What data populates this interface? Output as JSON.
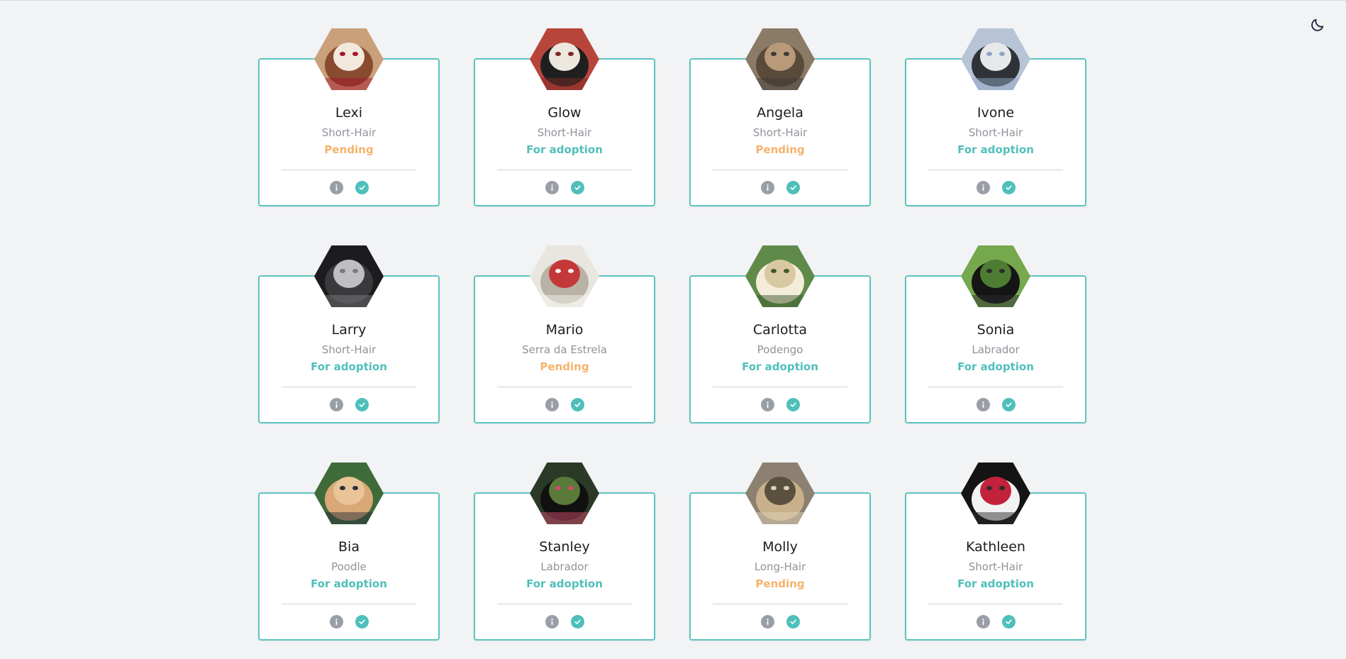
{
  "header": {
    "theme_toggle_icon": "moon-icon"
  },
  "colors": {
    "accent": "#5ec4c0",
    "pending": "#f6b26b",
    "for_adoption": "#4fbfbb",
    "background": "#f2f3f5"
  },
  "pets": [
    {
      "name": "Lexi",
      "breed": "Short-Hair",
      "status": "Pending",
      "status_key": "pending",
      "photo": [
        "#c9a07a",
        "#8a4a2e",
        "#f2e8dc",
        "#a4162c"
      ]
    },
    {
      "name": "Glow",
      "breed": "Short-Hair",
      "status": "For adoption",
      "status_key": "adopt",
      "photo": [
        "#b8453a",
        "#1f1f1f",
        "#ece7df",
        "#7a2a24"
      ]
    },
    {
      "name": "Angela",
      "breed": "Short-Hair",
      "status": "Pending",
      "status_key": "pending",
      "photo": [
        "#8a7a66",
        "#5a4a3a",
        "#b89a7a",
        "#3e3a36"
      ]
    },
    {
      "name": "Ivone",
      "breed": "Short-Hair",
      "status": "For adoption",
      "status_key": "adopt",
      "photo": [
        "#b7c4d6",
        "#2f3236",
        "#e6e8ea",
        "#8ea4c0"
      ]
    },
    {
      "name": "Larry",
      "breed": "Short-Hair",
      "status": "For adoption",
      "status_key": "adopt",
      "photo": [
        "#1c1c1e",
        "#3a3a3c",
        "#bfbfc2",
        "#7a7a7e"
      ]
    },
    {
      "name": "Mario",
      "breed": "Serra da Estrela",
      "status": "Pending",
      "status_key": "pending",
      "photo": [
        "#e9e6e0",
        "#b9b2a6",
        "#c43838",
        "#f4f2ee"
      ]
    },
    {
      "name": "Carlotta",
      "breed": "Podengo",
      "status": "For adoption",
      "status_key": "adopt",
      "photo": [
        "#5f8a4a",
        "#f3ecd8",
        "#d9c9a2",
        "#3e5a2e"
      ]
    },
    {
      "name": "Sonia",
      "breed": "Labrador",
      "status": "For adoption",
      "status_key": "adopt",
      "photo": [
        "#76a84e",
        "#151515",
        "#4d7c32",
        "#2c2c2c"
      ]
    },
    {
      "name": "Bia",
      "breed": "Poodle",
      "status": "For adoption",
      "status_key": "adopt",
      "photo": [
        "#3f6a3a",
        "#d9a876",
        "#e8c498",
        "#2a2f3a"
      ]
    },
    {
      "name": "Stanley",
      "breed": "Labrador",
      "status": "For adoption",
      "status_key": "adopt",
      "photo": [
        "#2a3a26",
        "#101010",
        "#5a7a3a",
        "#d04a6a"
      ]
    },
    {
      "name": "Molly",
      "breed": "Long-Hair",
      "status": "Pending",
      "status_key": "pending",
      "photo": [
        "#8c8070",
        "#c8b08a",
        "#5a5040",
        "#e0d2b8"
      ]
    },
    {
      "name": "Kathleen",
      "breed": "Short-Hair",
      "status": "For adoption",
      "status_key": "adopt",
      "photo": [
        "#141414",
        "#f2f2f2",
        "#c2223c",
        "#2c2c2c"
      ]
    }
  ],
  "card_actions": {
    "info_icon": "info-icon",
    "confirm_icon": "check-badge-icon"
  }
}
